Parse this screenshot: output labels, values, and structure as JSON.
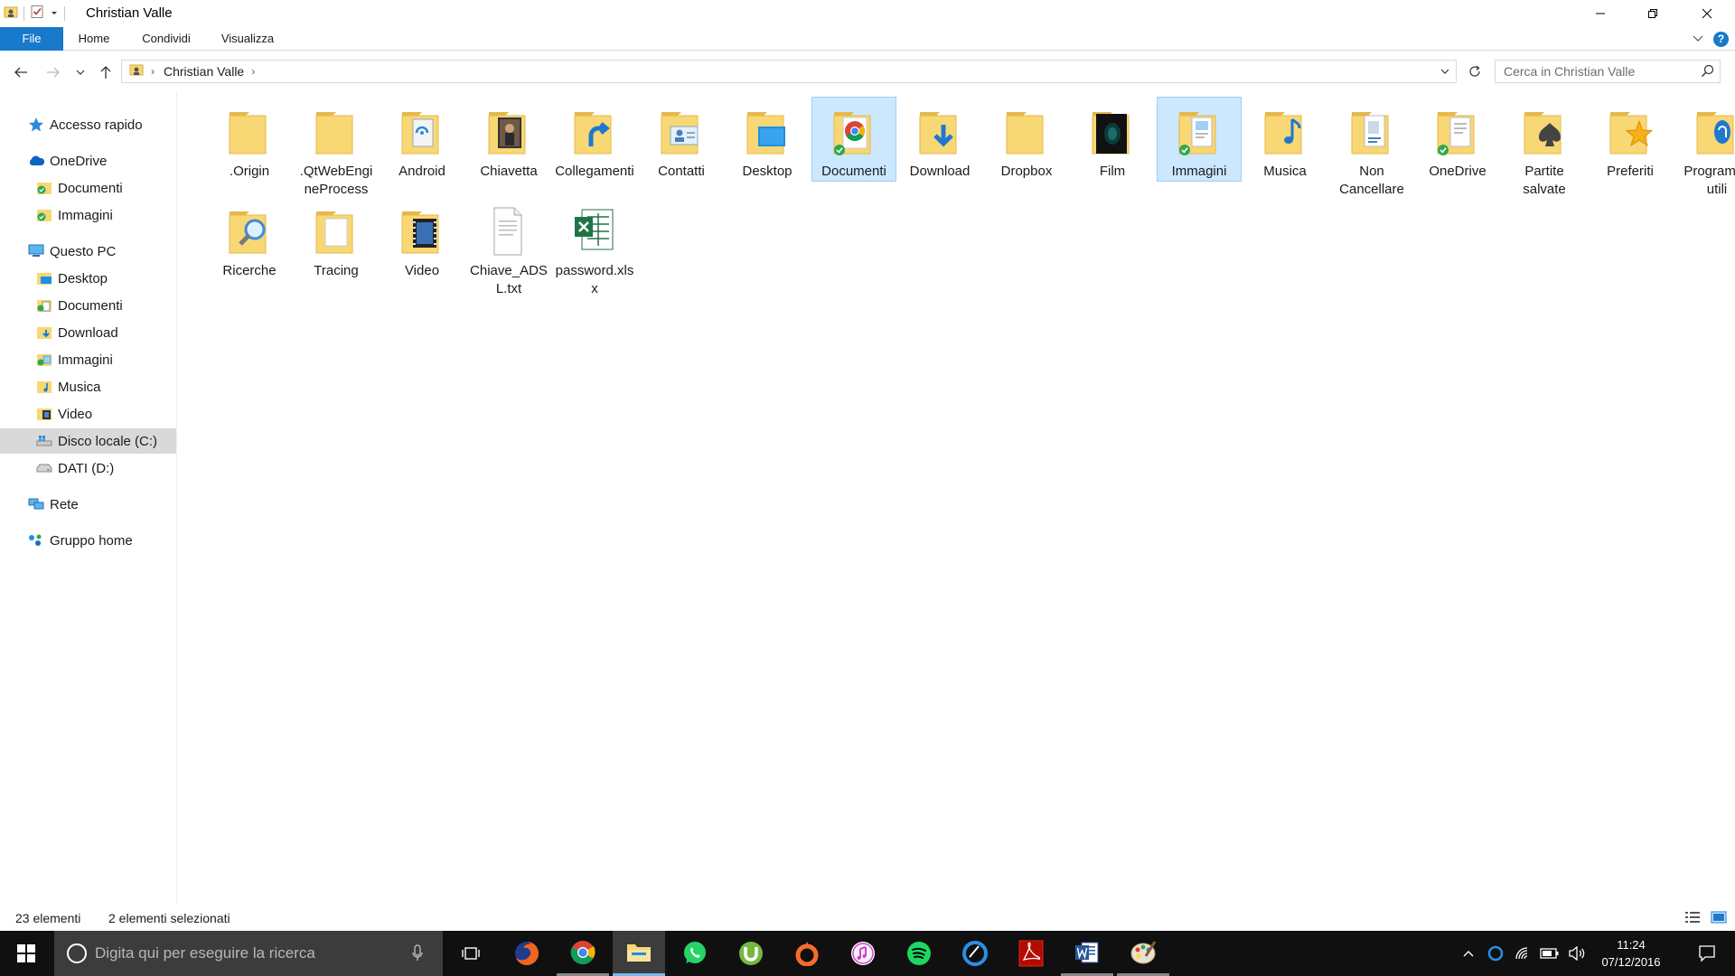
{
  "window": {
    "title": "Christian Valle"
  },
  "ribbon": {
    "tabs": [
      "File",
      "Home",
      "Condividi",
      "Visualizza"
    ],
    "help_label": "?"
  },
  "address": {
    "breadcrumb": [
      "Christian Valle"
    ],
    "search_placeholder": "Cerca in Christian Valle"
  },
  "nav_pane": {
    "quick_access": "Accesso rapido",
    "onedrive": {
      "label": "OneDrive",
      "children": [
        "Documenti",
        "Immagini"
      ]
    },
    "this_pc": {
      "label": "Questo PC",
      "children": [
        "Desktop",
        "Documenti",
        "Download",
        "Immagini",
        "Musica",
        "Video",
        "Disco locale (C:)",
        "DATI (D:)"
      ],
      "selected": "Disco locale (C:)"
    },
    "network": "Rete",
    "homegroup": "Gruppo home"
  },
  "items": [
    {
      "name": ".Origin",
      "icon": "folder-icon",
      "selected": false
    },
    {
      "name": ".QtWebEngineProcess",
      "icon": "folder-icon",
      "selected": false
    },
    {
      "name": "Android",
      "icon": "folder-android-icon",
      "selected": false
    },
    {
      "name": "Chiavetta",
      "icon": "folder-photo-icon",
      "selected": false
    },
    {
      "name": "Collegamenti",
      "icon": "folder-links-icon",
      "selected": false
    },
    {
      "name": "Contatti",
      "icon": "folder-contacts-icon",
      "selected": false
    },
    {
      "name": "Desktop",
      "icon": "folder-desktop-icon",
      "selected": false
    },
    {
      "name": "Documenti",
      "icon": "folder-chrome-icon",
      "selected": true
    },
    {
      "name": "Download",
      "icon": "folder-download-icon",
      "selected": false
    },
    {
      "name": "Dropbox",
      "icon": "folder-icon",
      "selected": false
    },
    {
      "name": "Film",
      "icon": "folder-film-icon",
      "selected": false
    },
    {
      "name": "Immagini",
      "icon": "folder-pictures-icon",
      "selected": true
    },
    {
      "name": "Musica",
      "icon": "folder-music-icon",
      "selected": false
    },
    {
      "name": "Non Cancellare",
      "icon": "folder-docs-icon",
      "selected": false
    },
    {
      "name": "OneDrive",
      "icon": "folder-onedrive-icon",
      "selected": false
    },
    {
      "name": "Partite salvate",
      "icon": "folder-games-icon",
      "selected": false
    },
    {
      "name": "Preferiti",
      "icon": "folder-favorites-icon",
      "selected": false
    },
    {
      "name": "Programmi utili",
      "icon": "folder-programs-icon",
      "selected": false
    },
    {
      "name": "Ricerche",
      "icon": "folder-search-icon",
      "selected": false
    },
    {
      "name": "Tracing",
      "icon": "folder-empty-icon",
      "selected": false
    },
    {
      "name": "Video",
      "icon": "folder-video-icon",
      "selected": false
    },
    {
      "name": "Chiave_ADSL.txt",
      "icon": "text-file-icon",
      "selected": false
    },
    {
      "name": "password.xlsx",
      "icon": "excel-file-icon",
      "selected": false
    }
  ],
  "status": {
    "count": "23 elementi",
    "selection": "2 elementi selezionati"
  },
  "taskbar": {
    "search_placeholder": "Digita qui per eseguire la ricerca",
    "apps": [
      "task-view",
      "firefox",
      "chrome",
      "file-explorer",
      "whatsapp",
      "utorrent",
      "origin",
      "itunes",
      "spotify",
      "ccleaner",
      "acrobat-reader",
      "word",
      "paint"
    ],
    "time": "11:24",
    "date": "07/12/2016"
  },
  "colors": {
    "accent": "#1979ca",
    "selection_bg": "#cce8ff",
    "selection_border": "#99d1ff",
    "folder": "#f8d775",
    "folder_dark": "#e6b84a",
    "taskbar": "#101010",
    "sync_green": "#2fa84f"
  }
}
